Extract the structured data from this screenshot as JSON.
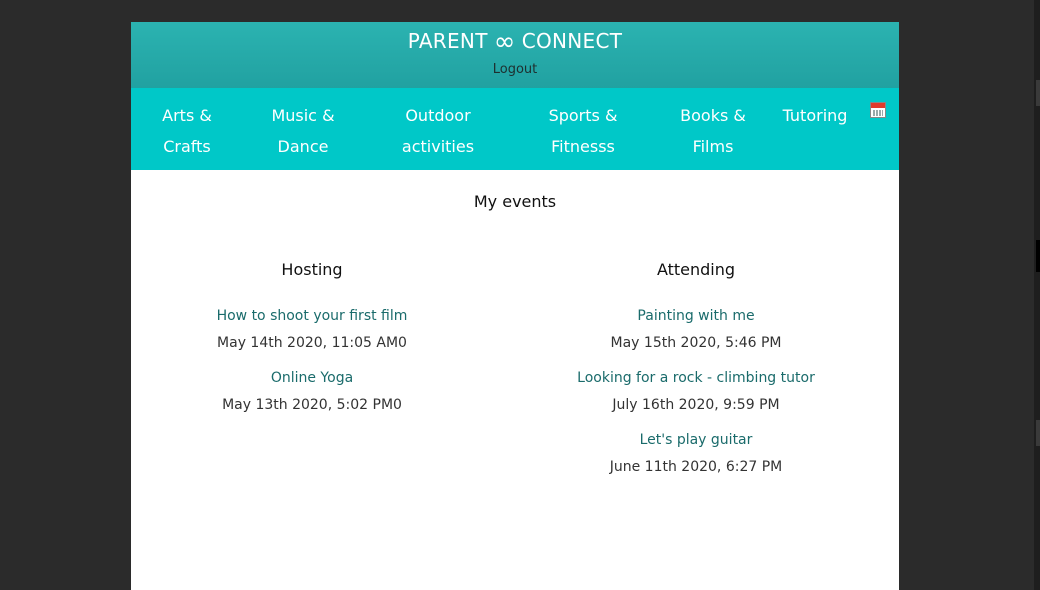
{
  "header": {
    "brand_left": "PARENT",
    "brand_right": "CONNECT",
    "brand_icon": "infinity-icon",
    "logout_label": "Logout"
  },
  "nav": {
    "items": [
      {
        "line1": "Arts &",
        "line2": "Crafts"
      },
      {
        "line1": "Music &",
        "line2": "Dance"
      },
      {
        "line1": "Outdoor",
        "line2": "activities"
      },
      {
        "line1": "Sports &",
        "line2": "Fitnesss"
      },
      {
        "line1": "Books &",
        "line2": "Films"
      },
      {
        "line1": "Tutoring",
        "line2": ""
      }
    ],
    "calendar_icon": "calendar-icon"
  },
  "main": {
    "title": "My events",
    "hosting": {
      "title": "Hosting",
      "events": [
        {
          "title": "How to shoot your first film",
          "date": "May 14th 2020, 11:05 AM0"
        },
        {
          "title": "Online Yoga",
          "date": "May 13th 2020, 5:02 PM0"
        }
      ]
    },
    "attending": {
      "title": "Attending",
      "events": [
        {
          "title": "Painting with me",
          "date": "May 15th 2020, 5:46 PM"
        },
        {
          "title": "Looking for a rock - climbing tutor",
          "date": "July 16th 2020, 9:59 PM"
        },
        {
          "title": "Let's play guitar",
          "date": "June 11th 2020, 6:27 PM"
        }
      ]
    }
  },
  "colors": {
    "header_bg": "#21a1a1",
    "nav_bg": "#00c8c8",
    "event_link": "#1a6b6b",
    "backdrop": "#2b2b2b"
  }
}
